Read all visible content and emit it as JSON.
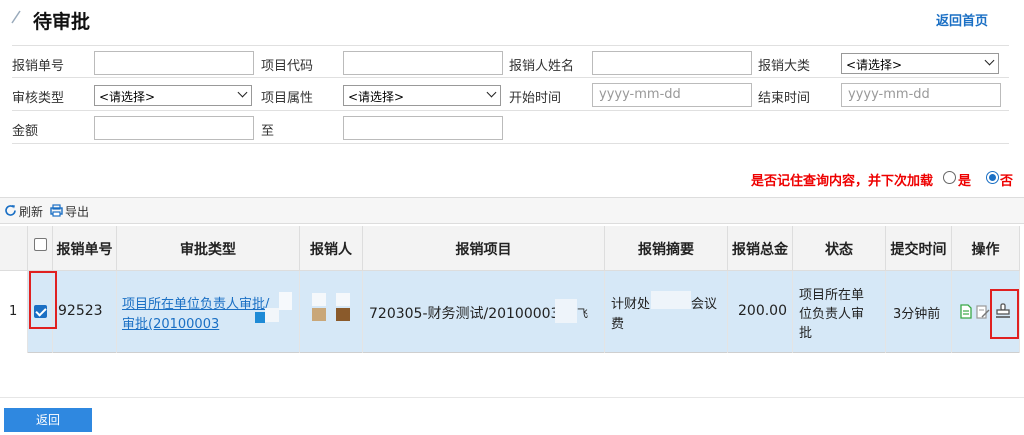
{
  "header": {
    "title": "待审批",
    "home_link": "返回首页"
  },
  "form": {
    "row1": {
      "l1": "报销单号",
      "v1": "",
      "l2": "项目代码",
      "v2": "",
      "l3": "报销人姓名",
      "v3": "",
      "l4": "报销大类",
      "s4": "<请选择>"
    },
    "row2": {
      "l1": "审核类型",
      "s1": "<请选择>",
      "l2": "项目属性",
      "s2": "<请选择>",
      "l3": "开始时间",
      "p3": "yyyy-mm-dd",
      "l4": "结束时间",
      "p4": "yyyy-mm-dd"
    },
    "row3": {
      "l1": "金额",
      "v1": "",
      "l2": "至",
      "v2": ""
    }
  },
  "remember": {
    "label": "是否记住查询内容，并下次加载",
    "yes": "是",
    "no": "否",
    "selected": "否"
  },
  "toolbar": {
    "refresh": "刷新",
    "export": "导出"
  },
  "table": {
    "headers": [
      "报销单号",
      "审批类型",
      "报销人",
      "报销项目",
      "报销摘要",
      "报销总金",
      "状态",
      "提交时间",
      "操作"
    ],
    "rows": [
      {
        "index": "1",
        "checked": true,
        "no": "92523",
        "type_line1": "项目所在单位负责人审批/",
        "type_line2": "审批(20100003",
        "project": "720305-财务测试/20100003-",
        "project_tail": "飞",
        "summary_a": "计财处",
        "summary_b": "会议",
        "summary_line2": "费",
        "amount": "200.00",
        "status_line1": "项目所在单",
        "status_line2": "位负责人审",
        "status_line3": "批",
        "time": "3分钟前"
      }
    ]
  },
  "footer": {
    "back": "返回"
  },
  "colors": {
    "accent": "#1a6fc4",
    "highlight": "#e02020",
    "row_selected": "#d6e8f7"
  }
}
